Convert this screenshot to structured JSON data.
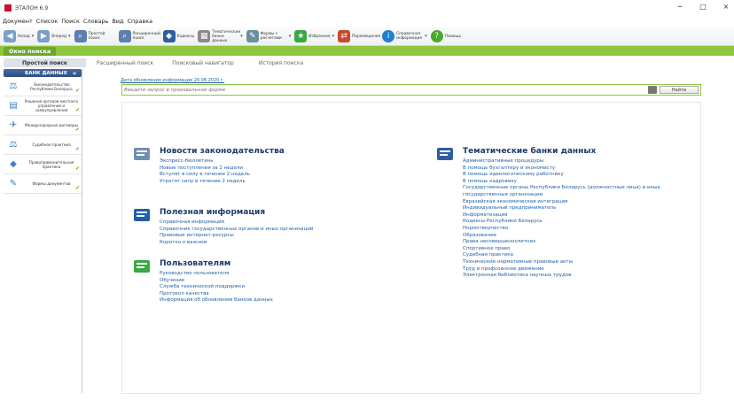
{
  "window": {
    "title": "ЭТАЛОН 6.9",
    "controls": [
      "−",
      "□",
      "×"
    ]
  },
  "menu": [
    "Документ",
    "Список",
    "Поиск",
    "Словарь",
    "Вид",
    "Справка"
  ],
  "toolbar": [
    {
      "label": "Назад",
      "icon": "back-arrow-icon",
      "color": "#7aa0c8",
      "dropdown": true
    },
    {
      "label": "Вперед",
      "icon": "forward-arrow-icon",
      "color": "#7aa0c8",
      "dropdown": true
    },
    {
      "label": "Простой поиск",
      "icon": "search-icon",
      "color": "#5b7fb0"
    },
    {
      "label": "Расширенный поиск",
      "icon": "advanced-search-icon",
      "color": "#5b7fb0"
    },
    {
      "label": "Кодексы",
      "icon": "codex-icon",
      "color": "#2f5f9f"
    },
    {
      "label": "Тематические банки данных",
      "icon": "thematic-bank-icon",
      "color": "#8a8a8a",
      "dropdown": true
    },
    {
      "label": "Формы с расчетами",
      "icon": "forms-icon",
      "color": "#6b8f9f",
      "dropdown": true
    },
    {
      "label": "Избранное",
      "icon": "favorites-star-icon",
      "color": "#3aa845",
      "dropdown": true
    },
    {
      "label": "Перемещение",
      "icon": "move-icon",
      "color": "#c84a2a"
    },
    {
      "label": "Справочная информация",
      "icon": "info-icon",
      "color": "#1f7fd0",
      "dropdown": true
    },
    {
      "label": "Помощь",
      "icon": "help-icon",
      "color": "#4aa82d"
    }
  ],
  "window_tab": "Окно поиска",
  "search_tabs": [
    "Простой поиск",
    "Расширенный поиск",
    "Поисковый навигатор",
    "История поиска"
  ],
  "sidebar": {
    "header": "БАНК ДАННЫХ",
    "items": [
      {
        "label": "Законодательство Республики Беларусь",
        "icon": "law-book-icon"
      },
      {
        "label": "Решения органов местного управления и самоуправления",
        "icon": "local-gov-icon"
      },
      {
        "label": "Международные договоры",
        "icon": "international-treaty-icon"
      },
      {
        "label": "Судебная практика",
        "icon": "court-icon"
      },
      {
        "label": "Правоприменительная практика",
        "icon": "enforcement-icon"
      },
      {
        "label": "Формы документов",
        "icon": "forms-documents-icon"
      }
    ]
  },
  "main": {
    "update_date": "Дата обновления информации 20.08.2020 г.",
    "search_placeholder": "Введите запрос в произвольной форме",
    "find_label": "Найти",
    "sections_left": [
      {
        "title": "Новости законодательства",
        "icon": "news-icon",
        "links": [
          "Экспресс-бюллетень",
          "Новые поступления за 2 недели",
          "Вступят в силу в течение 2 недель",
          "Утратят силу в течение 2 недель"
        ]
      },
      {
        "title": "Полезная информация",
        "icon": "useful-info-icon",
        "links": [
          "Справочная информация",
          "Справочник государственных органов и иных организаций",
          "Правовые интернет-ресурсы",
          "Коротко о важном"
        ]
      },
      {
        "title": "Пользователям",
        "icon": "users-icon",
        "links": [
          "Руководство пользователя",
          "Обучение",
          "Служба технической поддержки",
          "Протокол качества",
          "Информация об обновлении банков данных"
        ]
      }
    ],
    "section_right": {
      "title": "Тематические банки данных",
      "icon": "databases-icon",
      "links": [
        "Административные процедуры",
        "В помощь бухгалтеру и экономисту",
        "В помощь идеологическому работнику",
        "В помощь кадровику",
        "Государственные органы Республики Беларусь (должностные лица) и иные государственные организации",
        "Евразийская экономическая интеграция",
        "Индивидуальный предприниматель",
        "Информатизация",
        "Кодексы Республики Беларусь",
        "Нормотворчество",
        "Образование",
        "Права несовершеннолетних",
        "Спортивное право",
        "Судебная практика",
        "Технические нормативные правовые акты",
        "Труд и профсоюзное движение",
        "Электронная библиотека научных трудов"
      ]
    }
  }
}
